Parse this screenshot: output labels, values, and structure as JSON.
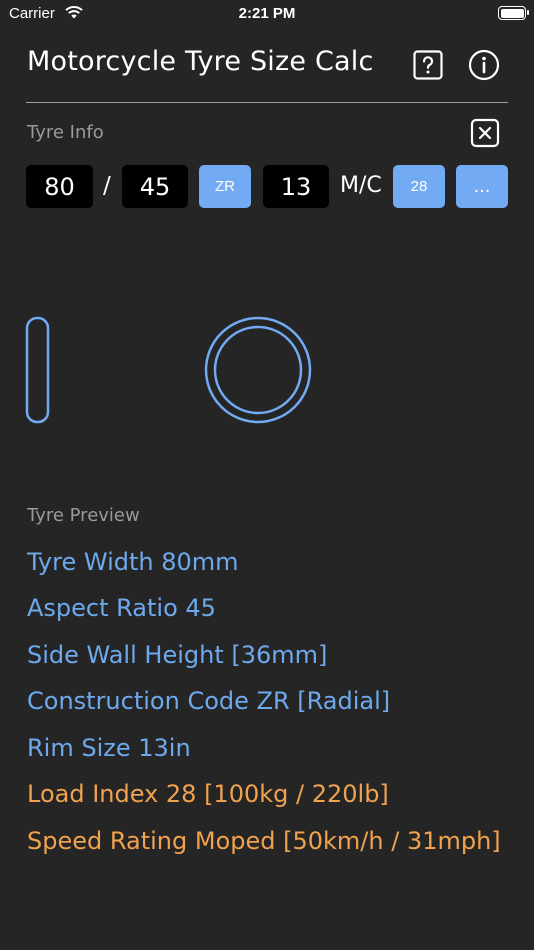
{
  "status_bar": {
    "carrier": "Carrier",
    "time": "2:21 PM"
  },
  "header": {
    "title": "Motorcycle Tyre Size Calc",
    "help_icon": "help-square-icon",
    "info_icon": "info-circle-icon"
  },
  "tyre_info": {
    "label": "Tyre Info",
    "clear_icon": "close-square-icon",
    "width": "80",
    "separator": "/",
    "aspect_ratio": "45",
    "construction": "ZR",
    "rim": "13",
    "mc": "M/C",
    "load_index": "28",
    "more": "..."
  },
  "preview": {
    "label": "Tyre Preview",
    "lines": [
      {
        "text": "Tyre Width 80mm",
        "color": "#6ea9ee"
      },
      {
        "text": "Aspect Ratio 45",
        "color": "#6ea9ee"
      },
      {
        "text": "Side Wall Height [36mm]",
        "color": "#6ea9ee"
      },
      {
        "text": "Construction Code ZR [Radial]",
        "color": "#6ea9ee"
      },
      {
        "text": "Rim Size 13in",
        "color": "#6ea9ee"
      },
      {
        "text": "Load Index 28 [100kg / 220lb]",
        "color": "#f0a24e"
      },
      {
        "text": "Speed Rating Moped [50km/h / 31mph]",
        "color": "#f0a24e"
      }
    ]
  },
  "colors": {
    "accent": "#72aaf3",
    "preview_blue": "#6ea9ee",
    "preview_orange": "#f0a24e",
    "background": "#252525"
  }
}
